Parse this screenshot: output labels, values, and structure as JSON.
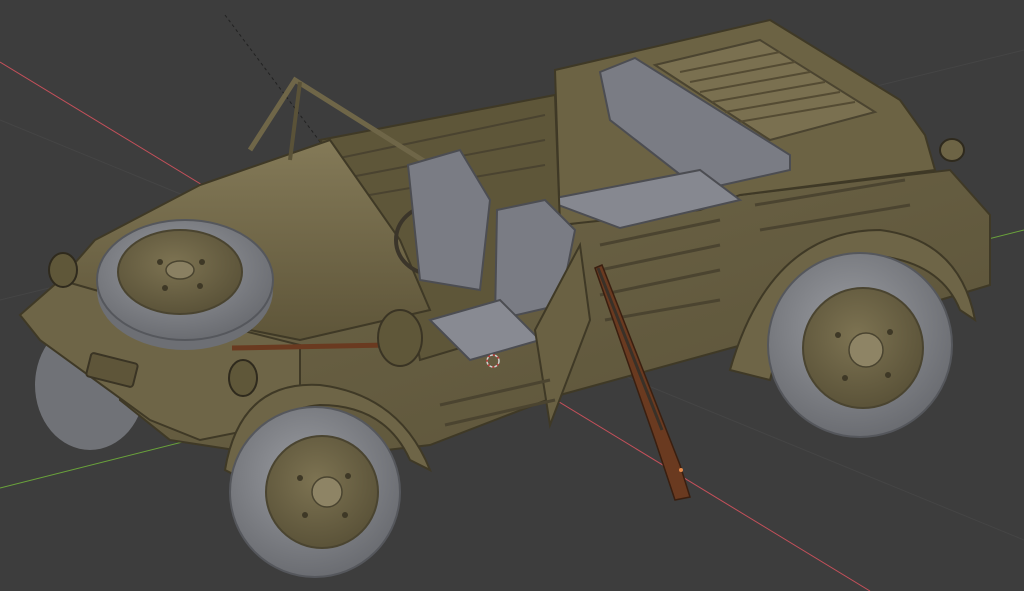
{
  "viewport": {
    "background_color": "#3d3d3d",
    "grid_line_color": "#4a4a4a",
    "x_axis_color": "#c4505a",
    "y_axis_color": "#6aa33b"
  },
  "model": {
    "body_color": "#6e6547",
    "body_shadow_color": "#574f36",
    "body_highlight_color": "#857b5a",
    "tire_color": "#85878c",
    "seat_color": "#7a7c84",
    "wood_color": "#6a3a20",
    "metal_color": "#3a3128"
  },
  "overlays": {
    "cursor_3d_icon": "3d-cursor-icon",
    "cursor_color": "#d0d0d0",
    "cursor_accent": "#c43c3c"
  }
}
